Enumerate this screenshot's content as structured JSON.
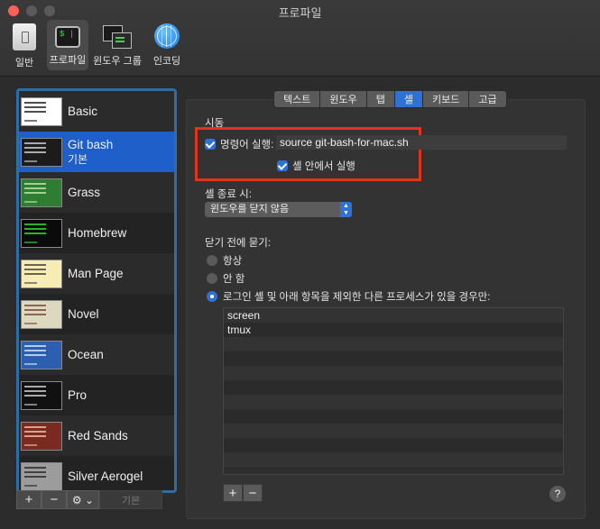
{
  "window": {
    "title": "프로파일"
  },
  "toolbar": {
    "items": [
      {
        "label": "일반",
        "icon": "general-switch-icon"
      },
      {
        "label": "프로파일",
        "icon": "terminal-profile-icon"
      },
      {
        "label": "윈도우 그룹",
        "icon": "window-group-icon"
      },
      {
        "label": "인코딩",
        "icon": "globe-icon"
      }
    ],
    "active": "프로파일"
  },
  "profiles": {
    "items": [
      {
        "name": "Basic",
        "sub": ""
      },
      {
        "name": "Git bash",
        "sub": "기본"
      },
      {
        "name": "Grass",
        "sub": ""
      },
      {
        "name": "Homebrew",
        "sub": ""
      },
      {
        "name": "Man Page",
        "sub": ""
      },
      {
        "name": "Novel",
        "sub": ""
      },
      {
        "name": "Ocean",
        "sub": ""
      },
      {
        "name": "Pro",
        "sub": ""
      },
      {
        "name": "Red Sands",
        "sub": ""
      },
      {
        "name": "Silver Aerogel",
        "sub": ""
      }
    ],
    "selected": "Git bash",
    "thumb_colors": [
      "#ffffff",
      "#1c1c1c",
      "#2e7d32",
      "#0b0b0b",
      "#f7ecb4",
      "#ddd8c0",
      "#2c5fb0",
      "#111111",
      "#7a2a20",
      "#9c9c9c"
    ],
    "thumb_ink": [
      "#222222",
      "#cfcfcf",
      "#bfe6a6",
      "#33dd33",
      "#444444",
      "#7a4a3a",
      "#d8e6ff",
      "#cfcfcf",
      "#f1c0a0",
      "#2a2a2a"
    ]
  },
  "list_footer": {
    "add": "+",
    "remove": "−",
    "gear": "⚙︎ ⌄",
    "default": "기본"
  },
  "tabs": {
    "items": [
      "텍스트",
      "윈도우",
      "탭",
      "셸",
      "키보드",
      "고급"
    ],
    "active": "셸"
  },
  "startup": {
    "heading": "시동",
    "run_command_label": "명령어 실행:",
    "run_command_value": "source git-bash-for-mac.sh",
    "run_in_shell_label": "셸 안에서 실행"
  },
  "shell_exit": {
    "heading": "셸 종료 시:",
    "option": "윈도우를 닫지 않음"
  },
  "ask_before_closing": {
    "heading": "닫기 전에 묻기:",
    "options": [
      "항상",
      "안 함",
      "로그인 셸 및 아래 항목을 제외한 다른 프로세스가 있을 경우만:"
    ],
    "selected": 2,
    "processes": [
      "screen",
      "tmux",
      "",
      "",
      "",
      "",
      "",
      "",
      "",
      "",
      ""
    ]
  },
  "process_buttons": {
    "add": "+",
    "remove": "−"
  },
  "help": "?",
  "colors": {
    "accent": "#2f72d6",
    "highlight": "#e0341d",
    "selection": "#1f5fc9"
  }
}
